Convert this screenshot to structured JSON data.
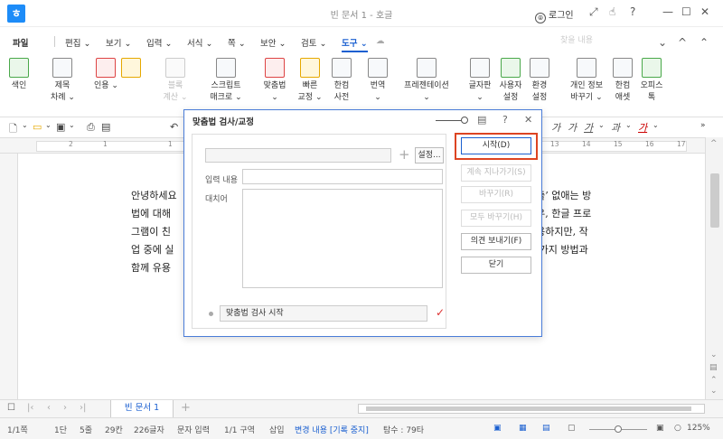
{
  "window": {
    "app_logo": "ㅎ",
    "title": "빈 문서 1 - 호글",
    "login_label": "로그인"
  },
  "menu": {
    "items": [
      "파일",
      "편집",
      "보기",
      "입력",
      "서식",
      "쪽",
      "보안",
      "검토",
      "도구"
    ],
    "active": "도구",
    "search_placeholder": "찾을 내용"
  },
  "ribbon": {
    "groups": [
      {
        "label1": "색인",
        "label2": "",
        "disabled": false
      },
      {
        "label1": "제목",
        "label2": "차례",
        "disabled": false
      },
      {
        "label1": "인용",
        "label2": "",
        "disabled": false
      },
      {
        "label1": "블록",
        "label2": "계산",
        "disabled": true
      },
      {
        "label1": "스크립트",
        "label2": "매크로",
        "disabled": false
      },
      {
        "label1": "맞춤법",
        "label2": "",
        "disabled": false
      },
      {
        "label1": "빠른",
        "label2": "교정",
        "disabled": false
      },
      {
        "label1": "한컴",
        "label2": "사전",
        "disabled": false
      },
      {
        "label1": "번역",
        "label2": "",
        "disabled": false
      },
      {
        "label1": "프레젠테이션",
        "label2": "",
        "disabled": false
      },
      {
        "label1": "글자판",
        "label2": "",
        "disabled": false
      },
      {
        "label1": "사용자",
        "label2": "설정",
        "disabled": false
      },
      {
        "label1": "환경",
        "label2": "설정",
        "disabled": false
      },
      {
        "label1": "개인 정보",
        "label2": "바꾸기",
        "disabled": false
      },
      {
        "label1": "한컴",
        "label2": "애셋",
        "disabled": false
      },
      {
        "label1": "오피스",
        "label2": "톡",
        "disabled": false
      }
    ]
  },
  "ruler": {
    "numbers": [
      "2",
      "1",
      "1",
      "13",
      "14",
      "15",
      "16",
      "17"
    ]
  },
  "document": {
    "lines_left": [
      "안녕하세요",
      "법에 대해",
      "그램이 친",
      "업 중에 실",
      "함께 유용"
    ],
    "lines_right": [
      "간출’ 없애는 방",
      "경우, 한글 프로",
      "유용하지만, 작",
      "두 가지 방법과",
      ""
    ]
  },
  "tabs": {
    "doc_tab": "빈 문서 1"
  },
  "statusbar": {
    "page": "1/1쪽",
    "section": "1단",
    "line": "5줄",
    "col": "29칸",
    "chars": "226글자",
    "mode": "문자 입력",
    "zone": "1/1 구역",
    "insert": "삽입",
    "track": "변경 내용 [기록 중지]",
    "search": "탐수 : 79타",
    "zoom": "125%"
  },
  "dialog": {
    "title": "맞춤법 검사/교정",
    "settings_label": "설정...",
    "input_label": "입력 내용",
    "replace_label": "대치어",
    "status_text": "맞춤법 검사 시작",
    "buttons": {
      "start": "시작(D)",
      "skip": "계속 지나가기(S)",
      "replace": "바꾸기(R)",
      "replace_all": "모두 바꾸기(H)",
      "send_opinion": "의견 보내기(F)",
      "close": "닫기"
    }
  }
}
